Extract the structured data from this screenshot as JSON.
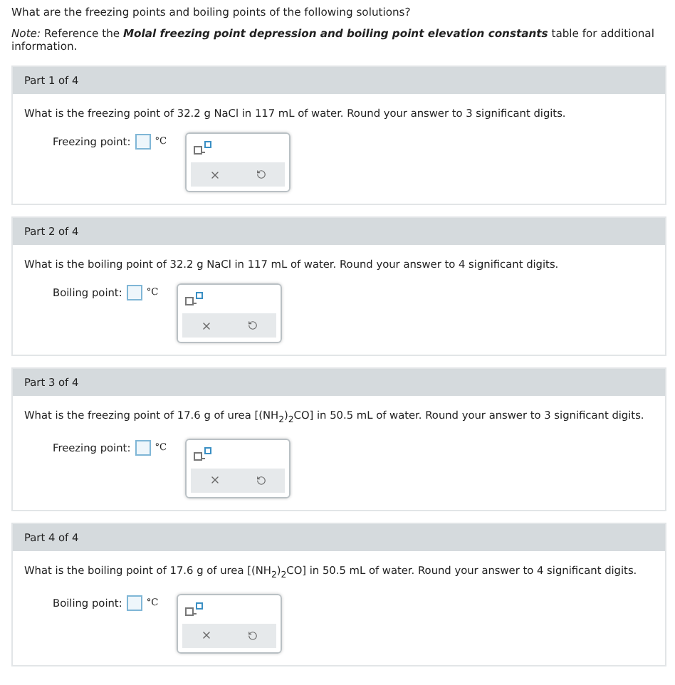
{
  "intro": "What are the freezing points and boiling points of the following solutions?",
  "note": "*Note:* Reference the **Molal freezing point depression and boiling point elevation constants** table for additional information.",
  "parts": [
    {
      "title": "Part 1 of 4",
      "question": "What is the freezing point of 32.2 g NaCl in 117 mL of water. Round your answer to 3 significant digits.",
      "label": "Freezing point:",
      "unit": "°C"
    },
    {
      "title": "Part 2 of 4",
      "question": "What is the boiling point of 32.2 g NaCl in 117 mL of water. Round your answer to 4 significant digits.",
      "label": "Boiling point:",
      "unit": "°C"
    },
    {
      "title": "Part 3 of 4",
      "question": "What is the freezing point of 17.6 g of urea [(NH$_{2}$)$_{2}$CO] in 50.5 mL of water. Round your answer to 3 significant digits.",
      "label": "Freezing point:",
      "unit": "°C"
    },
    {
      "title": "Part 4 of 4",
      "question": "What is the boiling point of 17.6 g of urea [(NH$_{2}$)$_{2}$CO] in 50.5 mL of water. Round your answer to 4 significant digits.",
      "label": "Boiling point:",
      "unit": "°C"
    }
  ]
}
